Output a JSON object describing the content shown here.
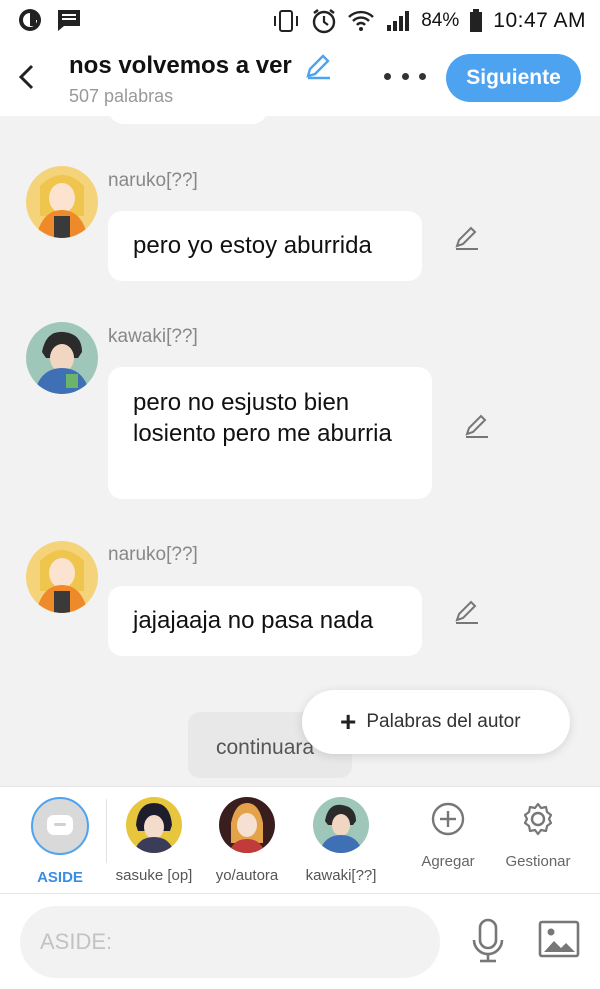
{
  "status_bar": {
    "battery": "84%",
    "time": "10:47 AM"
  },
  "header": {
    "title": "nos volvemos a ver",
    "word_count": "507 palabras",
    "next_label": "Siguiente"
  },
  "messages": [
    {
      "author": "naruko[??]",
      "text": "pero yo estoy aburrida"
    },
    {
      "author": "kawaki[??]",
      "text": "pero no esjusto bien losiento pero me aburria"
    },
    {
      "author": "naruko[??]",
      "text": "jajajaaja no pasa nada"
    }
  ],
  "continue_text": "continuara",
  "author_words_label": "Palabras del autor",
  "characters": [
    {
      "label": "ASIDE"
    },
    {
      "label": "sasuke [op]"
    },
    {
      "label": "yo/autora"
    },
    {
      "label": "kawaki[??]"
    }
  ],
  "tools": {
    "add_label": "Agregar",
    "manage_label": "Gestionar"
  },
  "input": {
    "placeholder": "ASIDE:"
  },
  "colors": {
    "accent": "#4da3f0",
    "background": "#f2f2f2"
  }
}
